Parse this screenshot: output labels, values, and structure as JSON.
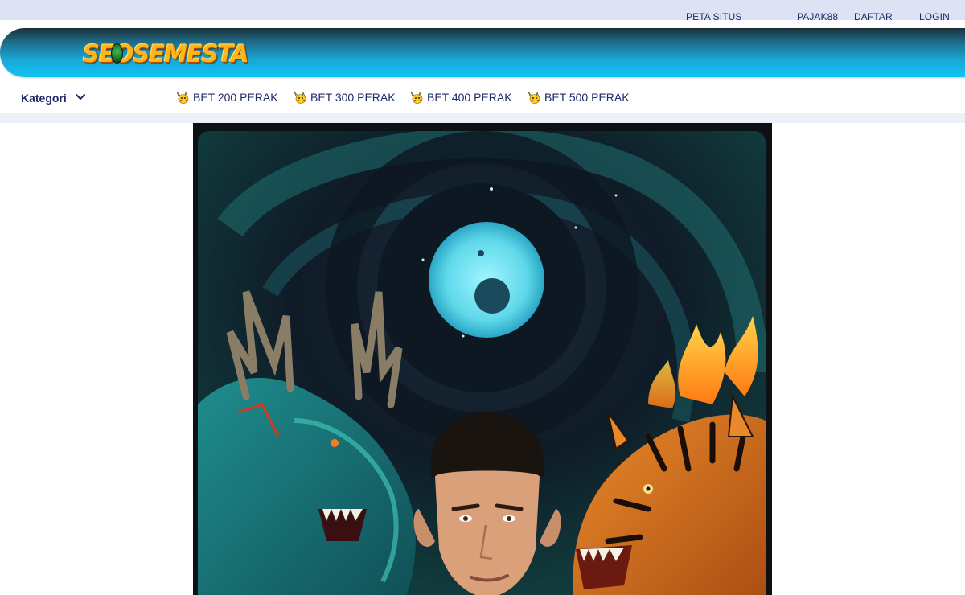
{
  "top_nav": {
    "peta_situs": "PETA SITUS",
    "pajak88": "PAJAK88",
    "daftar": "DAFTAR",
    "login": "LOGIN"
  },
  "logo": {
    "text": "SEOSEMESTA"
  },
  "menu": {
    "kategori_label": "Kategori",
    "items": [
      {
        "label": "BET 200 PERAK",
        "icon": "pikachu-icon"
      },
      {
        "label": "BET 300 PERAK",
        "icon": "pikachu-icon"
      },
      {
        "label": "BET 400 PERAK",
        "icon": "pikachu-icon"
      },
      {
        "label": "BET 500 PERAK",
        "icon": "pikachu-icon"
      }
    ]
  },
  "colors": {
    "nav_text": "#1f2b6a",
    "topbar_bg": "#dde3f5",
    "banner_accent": "#10c4f2",
    "logo_orange": "#ffb515"
  }
}
